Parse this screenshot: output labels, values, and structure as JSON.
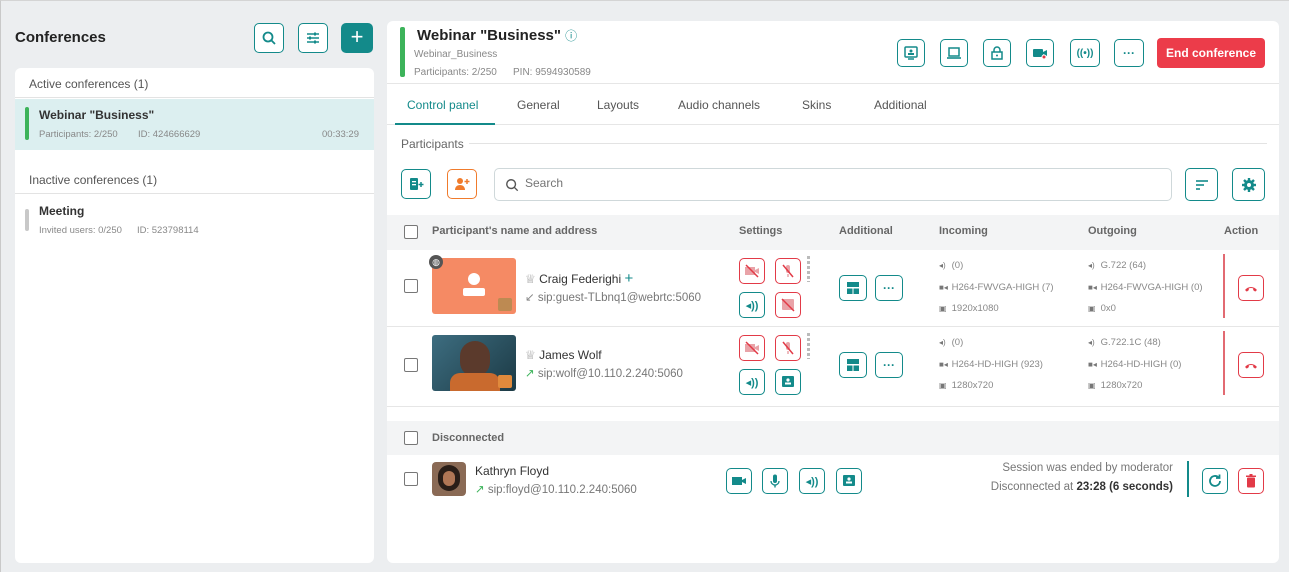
{
  "left": {
    "title": "Conferences",
    "active_header": "Active conferences (1)",
    "active": [
      {
        "name": "Webinar \"Business\"",
        "participants": "Participants: 2/250",
        "id": "ID: 424666629",
        "duration": "00:33:29"
      }
    ],
    "inactive_header": "Inactive conferences (1)",
    "inactive": [
      {
        "name": "Meeting",
        "invited": "Invited users: 0/250",
        "id": "ID: 523798114"
      }
    ]
  },
  "header": {
    "title": "Webinar \"Business\"",
    "subtitle": "Webinar_Business",
    "participants": "Participants: 2/250",
    "pin": "PIN: 9594930589",
    "end_label": "End conference"
  },
  "tabs": [
    "Control panel",
    "General",
    "Layouts",
    "Audio channels",
    "Skins",
    "Additional"
  ],
  "participants_label": "Participants",
  "search": {
    "placeholder": "Search"
  },
  "columns": {
    "name": "Participant's name and address",
    "settings": "Settings",
    "additional": "Additional",
    "incoming": "Incoming",
    "outgoing": "Outgoing",
    "action": "Action"
  },
  "rows": [
    {
      "name": "Craig Federighi",
      "address": "sip:guest-TLbnq1@webrtc:5060",
      "in_audio": "(0)",
      "in_video": "H264-FWVGA-HIGH (7)",
      "in_res": "1920x1080",
      "out_audio": "G.722 (64)",
      "out_video": "H264-FWVGA-HIGH (0)",
      "out_res": "0x0"
    },
    {
      "name": "James Wolf",
      "address": "sip:wolf@10.110.2.240:5060",
      "in_audio": "(0)",
      "in_video": "H264-HD-HIGH (923)",
      "in_res": "1280x720",
      "out_audio": "G.722.1C (48)",
      "out_video": "H264-HD-HIGH (0)",
      "out_res": "1280x720"
    }
  ],
  "disconnected": {
    "label": "Disconnected",
    "name": "Kathryn Floyd",
    "address": "sip:floyd@10.110.2.240:5060",
    "msg": "Session was ended by moderator",
    "disc_prefix": "Disconnected at",
    "disc_time": "23:28",
    "disc_dur": "(6 seconds)"
  },
  "colors": {
    "accent": "#138a8a",
    "danger": "#ec3c4a",
    "active_bar": "#3cb35a",
    "orange": "#f07b2c"
  }
}
